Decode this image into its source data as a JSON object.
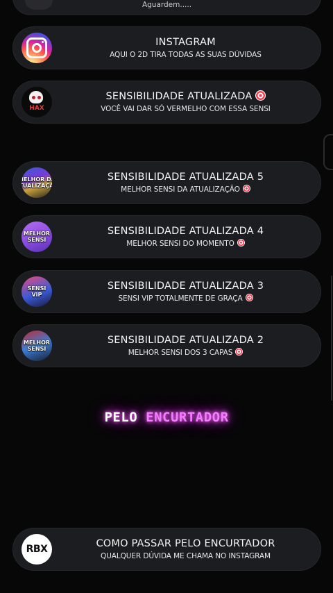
{
  "top_card": {
    "subtitle": "Aguardem....."
  },
  "cards": [
    {
      "title": "INSTAGRAM",
      "subtitle": "AQUI O 2D TIRA TODAS AS SUAS DÚVIDAS",
      "icon": "instagram-icon"
    },
    {
      "title": "SENSIBILIDADE ATUALIZADA",
      "subtitle": "VOCÊ VAI DAR SÓ VERMELHO COM ESSA SENSI",
      "icon": "skull-icon",
      "thumb_text": "HAX"
    },
    {
      "title": "SENSIBILIDADE ATUALIZADA 5",
      "subtitle": "MELHOR SENSI DA ATUALIZAÇÃO",
      "thumb_text": "MELHOR DA ATUALIZAÇÃO"
    },
    {
      "title": "SENSIBILIDADE ATUALIZADA 4",
      "subtitle": "MELHOR SENSI DO MOMENTO",
      "thumb_text": "MELHOR SENSI"
    },
    {
      "title": "SENSIBILIDADE ATUALIZADA 3",
      "subtitle": "SENSI VIP TOTALMENTE DE GRAÇA",
      "thumb_text": "SENSI VIP"
    },
    {
      "title": "SENSIBILIDADE ATUALIZADA 2",
      "subtitle": "MELHOR SENSI DOS 3 CAPAS",
      "thumb_text": "MELHOR SENSI"
    },
    {
      "title": "COMO PASSAR PELO ENCURTADOR",
      "subtitle": "QUALQUER DÚVIDA ME CHAMA NO INSTAGRAM",
      "thumb_text": "RBX"
    }
  ],
  "overlay": {
    "word1": "PELO",
    "word2": "ENCURTADOR"
  },
  "colors": {
    "background": "#070707",
    "card": "#1c1d21",
    "neon": "#f27cff",
    "target_red": "#ff3a4f"
  }
}
